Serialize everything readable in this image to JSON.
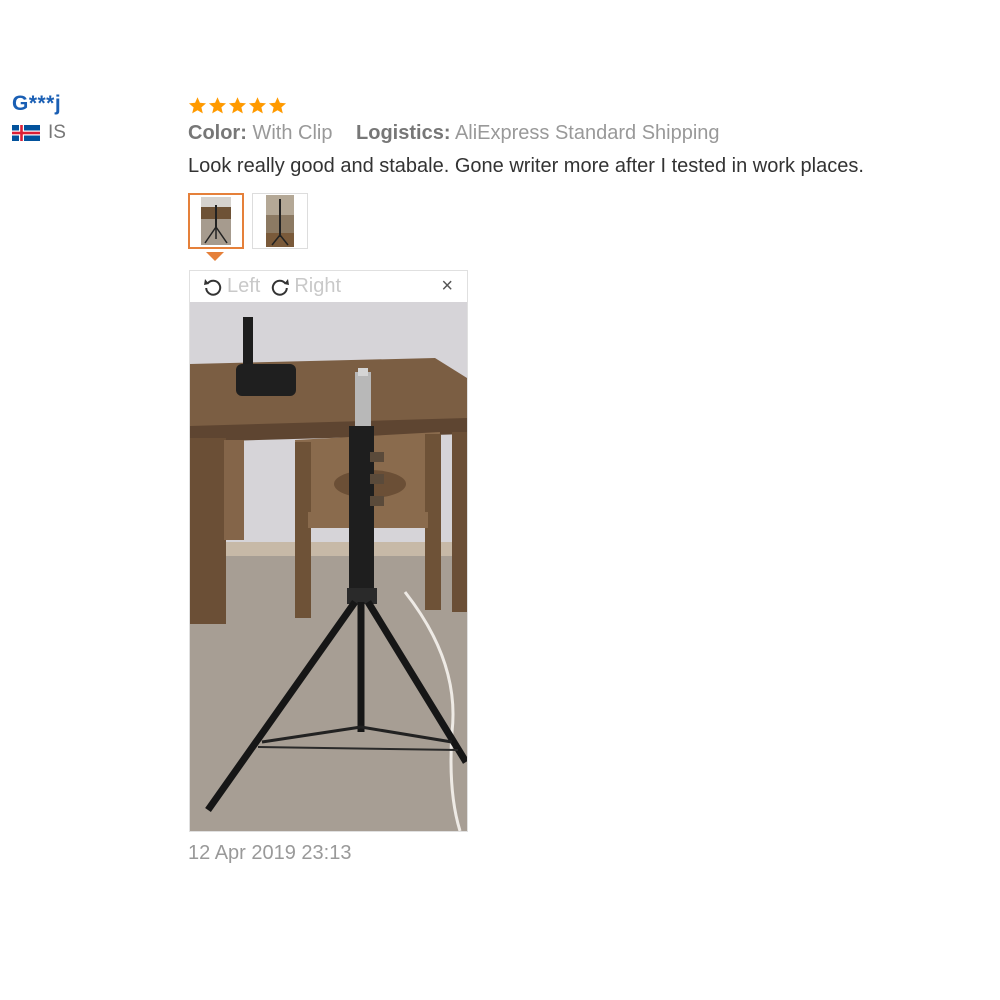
{
  "user": {
    "name": "G***j",
    "country_code": "IS",
    "flag_icon": "iceland-flag-icon"
  },
  "review": {
    "rating": 5,
    "star_color": "#ff9a00",
    "color_label": "Color:",
    "color_value": "With Clip",
    "logistics_label": "Logistics:",
    "logistics_value": "AliExpress Standard Shipping",
    "text": "Look really good and stabale. Gone writer more after I tested in work places.",
    "date": "12 Apr 2019 23:13",
    "thumbnails": [
      {
        "name": "photo-thumbnail-1",
        "selected": true
      },
      {
        "name": "photo-thumbnail-2",
        "selected": false
      }
    ]
  },
  "viewer": {
    "rotate_left_label": "Left",
    "rotate_right_label": "Right",
    "close_symbol": "×",
    "accent_color": "#e5803a"
  }
}
